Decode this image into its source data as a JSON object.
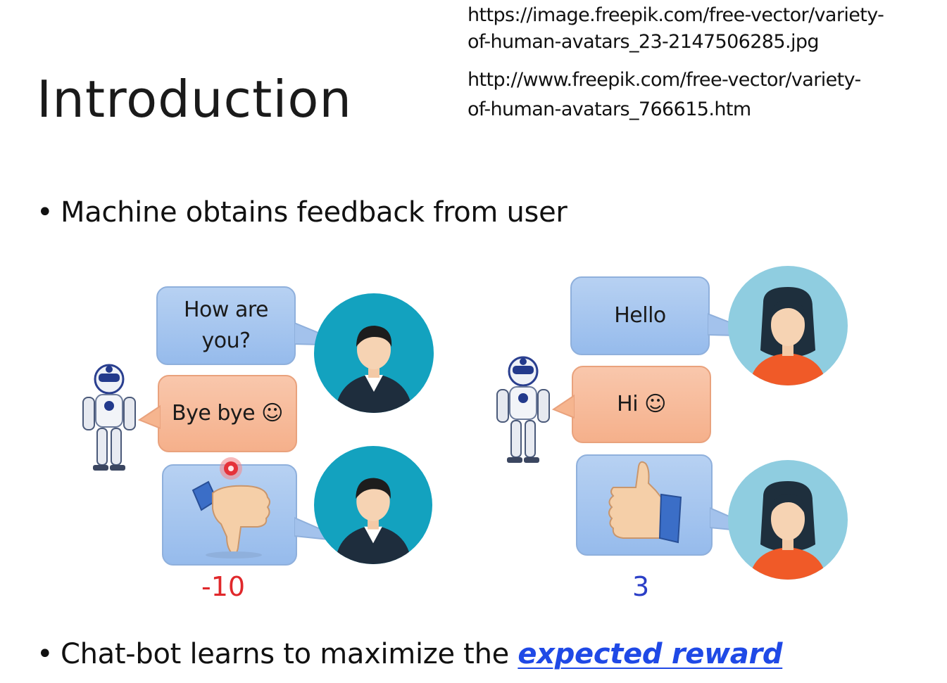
{
  "slide": {
    "title": "Introduction",
    "sources": [
      "https://image.freepik.com/free-vector/variety-",
      "of-human-avatars_23-2147506285.jpg",
      "http://www.freepik.com/free-vector/variety-",
      "of-human-avatars_766615.htm"
    ],
    "bullet1": "Machine obtains feedback from user",
    "bullet2_prefix": "Chat-bot learns to maximize the ",
    "bullet2_emphasis": "expected reward",
    "bullet_char": "•"
  },
  "left_example": {
    "user_message": [
      "How are",
      "you?"
    ],
    "bot_reply": "Bye bye ☺",
    "feedback_icon": "thumbs-down-icon",
    "reward": "-10",
    "reward_color": "#e0282b"
  },
  "right_example": {
    "user_message": [
      "Hello"
    ],
    "bot_reply": "Hi ☺",
    "feedback_icon": "thumbs-up-icon",
    "reward": "3",
    "reward_color": "#2b3fc7"
  },
  "colors": {
    "user_bubble": "#a9c7ef",
    "bot_bubble": "#f7bc9a",
    "male_avatar_bg": "#13a2bf",
    "female_avatar_bg": "#8fcde0",
    "emphasis": "#1f49e6",
    "pointer": "#e5323a"
  }
}
